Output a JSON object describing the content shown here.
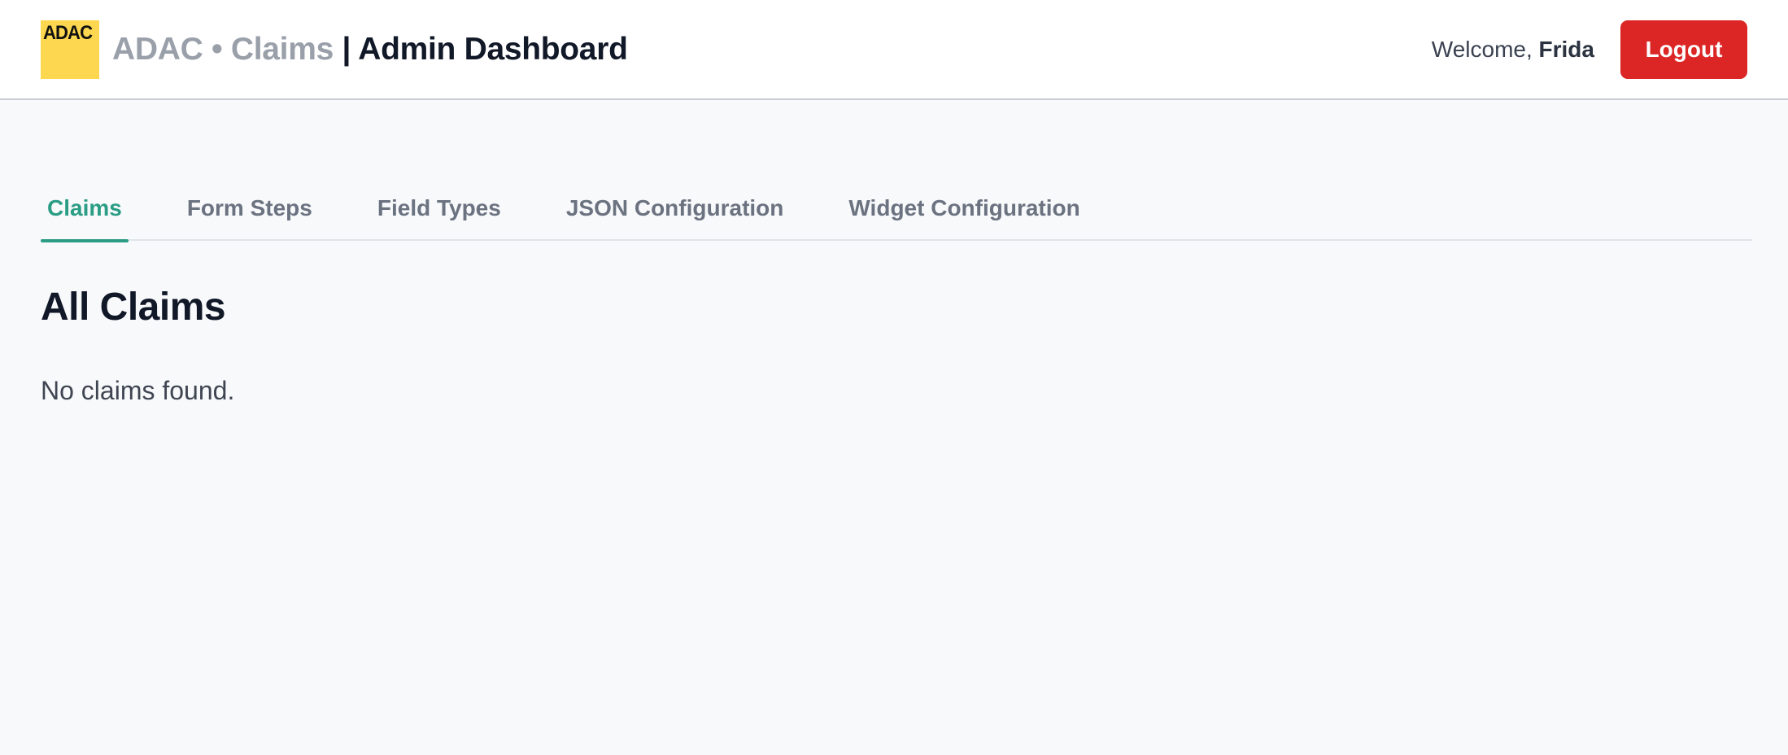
{
  "header": {
    "logo_text": "ADAC",
    "brand": "ADAC • Claims",
    "separator": " | ",
    "page_title": "Admin Dashboard",
    "welcome_prefix": "Welcome, ",
    "user_name": "Frida",
    "logout_label": "Logout"
  },
  "tabs": [
    {
      "label": "Claims",
      "active": true
    },
    {
      "label": "Form Steps",
      "active": false
    },
    {
      "label": "Field Types",
      "active": false
    },
    {
      "label": "JSON Configuration",
      "active": false
    },
    {
      "label": "Widget Configuration",
      "active": false
    }
  ],
  "main": {
    "heading": "All Claims",
    "empty_message": "No claims found."
  },
  "colors": {
    "logo_yellow": "#fcd74f",
    "logout_red": "#dc2626",
    "tab_active": "#2a9d84"
  }
}
